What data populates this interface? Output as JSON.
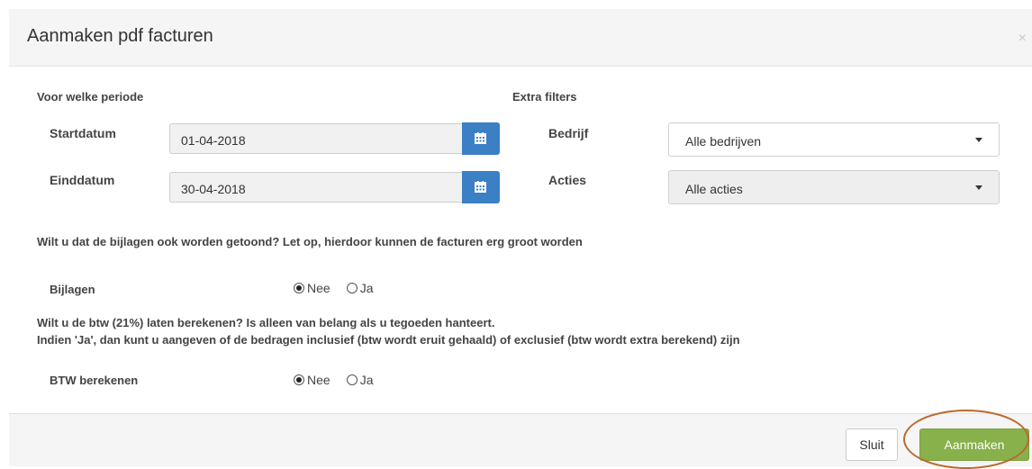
{
  "dialog": {
    "title": "Aanmaken pdf facturen",
    "close_icon": "close-icon"
  },
  "period": {
    "heading": "Voor welke periode",
    "start_label": "Startdatum",
    "start_value": "01-04-2018",
    "end_label": "Einddatum",
    "end_value": "30-04-2018",
    "calendar_icon": "calendar-icon"
  },
  "filters": {
    "heading": "Extra filters",
    "company_label": "Bedrijf",
    "company_value": "Alle bedrijven",
    "actions_label": "Acties",
    "actions_value": "Alle acties"
  },
  "attachments": {
    "question": "Wilt u dat de bijlagen ook worden getoond? Let op, hierdoor kunnen de facturen erg groot worden",
    "label": "Bijlagen",
    "option_no": "Nee",
    "option_yes": "Ja",
    "selected": "Nee"
  },
  "vat": {
    "question_line1": "Wilt u de btw (21%) laten berekenen? Is alleen van belang als u tegoeden hanteert.",
    "question_line2": "Indien 'Ja', dan kunt u aangeven of de bedragen inclusief (btw wordt eruit gehaald) of exclusief (btw wordt extra berekend) zijn",
    "label": "BTW berekenen",
    "option_no": "Nee",
    "option_yes": "Ja",
    "selected": "Nee"
  },
  "footer": {
    "close_label": "Sluit",
    "create_label": "Aanmaken"
  },
  "colors": {
    "calendar_button": "#3b7fc4",
    "create_button": "#88b04b",
    "highlight_ring": "#b86a2e"
  }
}
